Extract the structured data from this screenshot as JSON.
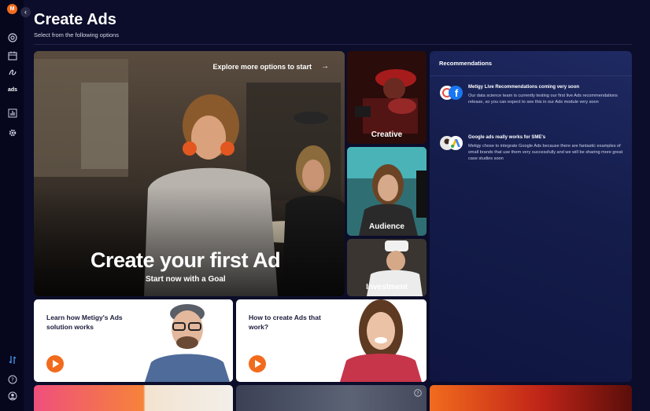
{
  "app": {
    "logo_letter": "M",
    "collapse_glyph": "‹",
    "sidebar_ads_label": "ads"
  },
  "header": {
    "title": "Create Ads",
    "subtitle": "Select from the following options"
  },
  "hero": {
    "explore_label": "Explore more options to start",
    "explore_arrow": "→",
    "title": "Create your first Ad",
    "subtitle": "Start now with a Goal"
  },
  "tiles": [
    {
      "label": "Creative"
    },
    {
      "label": "Audience"
    },
    {
      "label": "Investment"
    }
  ],
  "recommendations": {
    "title": "Recommendations",
    "items": [
      {
        "title": "Metigy Live Recommendations coming very soon",
        "body": "Our data science team is currently testing our first live Ads recommendations release, so you can expect to see this in our Ads module very soon"
      },
      {
        "title": "Google ads really works for SME's",
        "body": "Metigy chose to integrate Google Ads because there are fantastic examples of small brands that use them very successfully and we will be sharing more great case studies soon"
      }
    ]
  },
  "videos": [
    {
      "title": "Learn how Metigy's Ads solution works"
    },
    {
      "title": "How to create Ads that work?"
    }
  ],
  "colors": {
    "accent": "#f26b1d",
    "background": "#0b0d2a",
    "panel": "#141c4a"
  }
}
